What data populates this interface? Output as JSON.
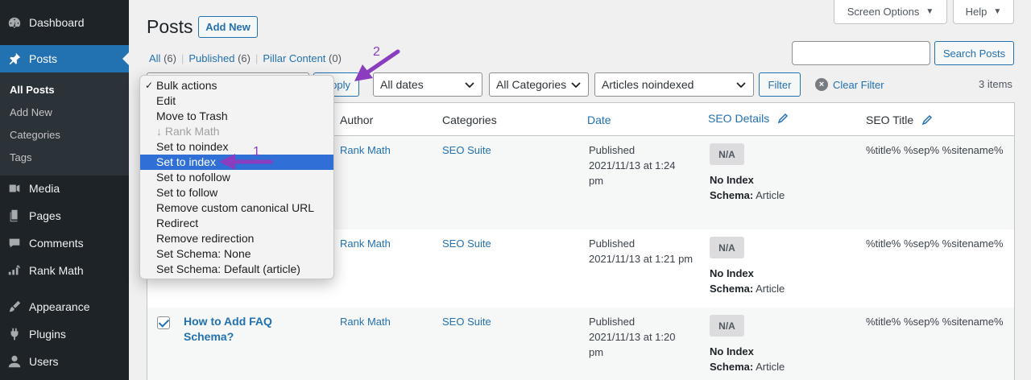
{
  "sidebar": {
    "items": [
      {
        "label": "Dashboard",
        "icon": "dashboard-icon"
      },
      {
        "label": "Posts",
        "icon": "pin-icon"
      },
      {
        "label": "Media",
        "icon": "media-icon"
      },
      {
        "label": "Pages",
        "icon": "pages-icon"
      },
      {
        "label": "Comments",
        "icon": "comments-icon"
      },
      {
        "label": "Rank Math",
        "icon": "rank-math-icon"
      },
      {
        "label": "Appearance",
        "icon": "appearance-icon"
      },
      {
        "label": "Plugins",
        "icon": "plugins-icon"
      },
      {
        "label": "Users",
        "icon": "users-icon"
      }
    ],
    "submenu": [
      "All Posts",
      "Add New",
      "Categories",
      "Tags"
    ]
  },
  "header": {
    "title": "Posts",
    "add_new": "Add New",
    "screen_options": "Screen Options",
    "help": "Help"
  },
  "views": {
    "all_label": "All",
    "all_count": "(6)",
    "published_label": "Published",
    "published_count": "(6)",
    "pillar_label": "Pillar Content",
    "pillar_count": "(0)",
    "separator": "|"
  },
  "search": {
    "value": "",
    "button": "Search Posts"
  },
  "tablenav": {
    "apply_partial": "pply",
    "dates": "All dates",
    "categories": "All Categories",
    "seo_filter": "Articles noindexed",
    "filter": "Filter",
    "clear_filter": "Clear Filter",
    "items_count": "3 items"
  },
  "bulk_dropdown": {
    "items": [
      {
        "label": "Bulk actions",
        "checked": true
      },
      {
        "label": "Edit"
      },
      {
        "label": "Move to Trash"
      },
      {
        "label": "↓ Rank Math",
        "disabled": true
      },
      {
        "label": "Set to noindex"
      },
      {
        "label": "Set to index",
        "selected": true
      },
      {
        "label": "Set to nofollow"
      },
      {
        "label": "Set to follow"
      },
      {
        "label": "Remove custom canonical URL"
      },
      {
        "label": "Redirect"
      },
      {
        "label": "Remove redirection"
      },
      {
        "label": "Set Schema: None"
      },
      {
        "label": "Set Schema: Default (article)"
      }
    ],
    "check_mark": "✓"
  },
  "table": {
    "columns": {
      "author": "Author",
      "categories": "Categories",
      "date": "Date",
      "seo_details": "SEO Details",
      "seo_title": "SEO Title"
    },
    "rows": [
      {
        "title": "",
        "author": "Rank Math",
        "category": "SEO Suite",
        "date_status": "Published",
        "date_line2": "2021/11/13 at 1:24",
        "date_line3": "pm",
        "badge": "N/A",
        "index_label": "No Index",
        "schema_label": "Schema:",
        "schema_value": "Article",
        "seo_title": "%title% %sep% %sitename%"
      },
      {
        "title": "",
        "author": "Rank Math",
        "category": "SEO Suite",
        "date_status": "Published",
        "date_line2": "2021/11/13 at 1:21 pm",
        "date_line3": "",
        "badge": "N/A",
        "index_label": "No Index",
        "schema_label": "Schema:",
        "schema_value": "Article",
        "seo_title": "%title% %sep% %sitename%"
      },
      {
        "title_line1": "How to Add FAQ",
        "title_line2": "Schema?",
        "author": "Rank Math",
        "category": "SEO Suite",
        "date_status": "Published",
        "date_line2": "2021/11/13 at 1:20",
        "date_line3": "pm",
        "badge": "N/A",
        "index_label": "No Index",
        "schema_label": "Schema:",
        "schema_value": "Article",
        "seo_title": "%title% %sep% %sitename%",
        "checked": true
      }
    ]
  },
  "annotations": {
    "one": "1",
    "two": "2"
  },
  "colors": {
    "sidebar_bg": "#1d2327",
    "accent": "#2271b1",
    "selection": "#2f6fd6",
    "annotation": "#8a3dbe"
  }
}
